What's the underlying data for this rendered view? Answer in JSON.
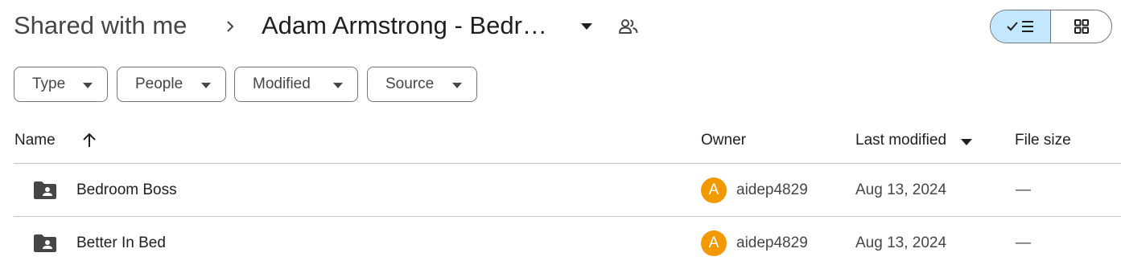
{
  "breadcrumb": {
    "root_label": "Shared with me",
    "separator_icon": "chevron-right-icon",
    "current_folder": "Adam Armstrong - Bedr…",
    "dropdown_icon": "arrow-drop-down-icon",
    "shared_icon": "people-icon"
  },
  "view_toggle": {
    "list_icon": "check-list-icon",
    "grid_icon": "grid-icon",
    "selected": "list",
    "selected_color": "#c2e7ff"
  },
  "filters": [
    {
      "label": "Type"
    },
    {
      "label": "People"
    },
    {
      "label": "Modified"
    },
    {
      "label": "Source"
    }
  ],
  "table": {
    "columns": {
      "name": "Name",
      "owner": "Owner",
      "last_modified": "Last modified",
      "file_size": "File size"
    },
    "sort_icon": "arrow-upward-icon",
    "rows": [
      {
        "icon": "shared-folder-icon",
        "name": "Bedroom Boss",
        "owner_initial": "A",
        "owner": "aidep4829",
        "modified": "Aug 13, 2024",
        "size": "—"
      },
      {
        "icon": "shared-folder-icon",
        "name": "Better In Bed",
        "owner_initial": "A",
        "owner": "aidep4829",
        "modified": "Aug 13, 2024",
        "size": "—"
      }
    ]
  },
  "colors": {
    "avatar": "#f29900",
    "accent": "#c2e7ff",
    "icon": "#444746"
  }
}
